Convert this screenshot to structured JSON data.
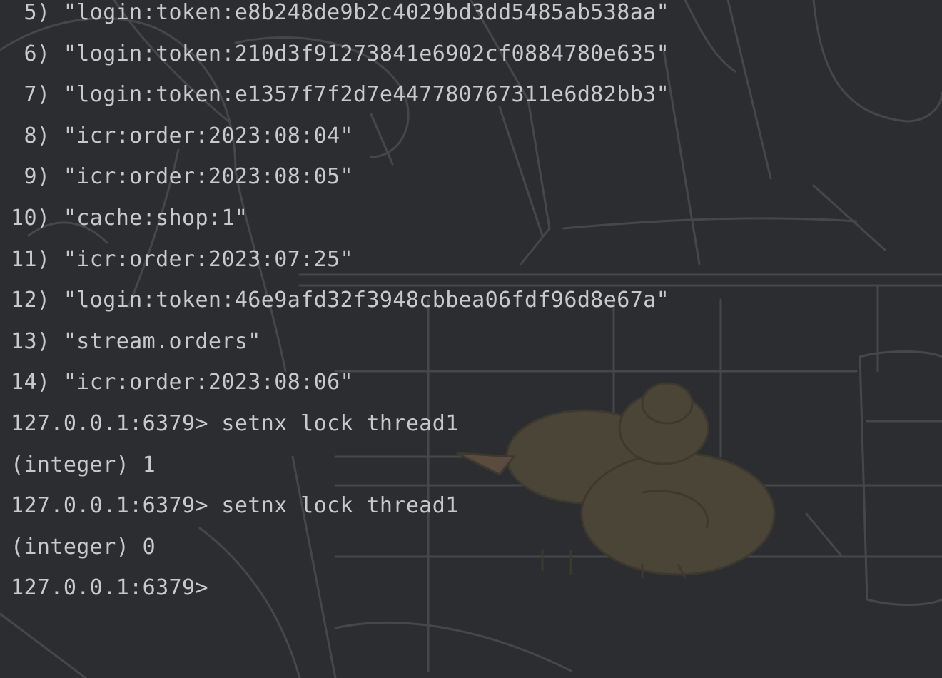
{
  "terminal": {
    "lines": [
      " 5) \"login:token:e8b248de9b2c4029bd3dd5485ab538aa\"",
      " 6) \"login:token:210d3f91273841e6902cf0884780e635\"",
      " 7) \"login:token:e1357f7f2d7e447780767311e6d82bb3\"",
      " 8) \"icr:order:2023:08:04\"",
      " 9) \"icr:order:2023:08:05\"",
      "10) \"cache:shop:1\"",
      "11) \"icr:order:2023:07:25\"",
      "12) \"login:token:46e9afd32f3948cbbea06fdf96d8e67a\"",
      "13) \"stream.orders\"",
      "14) \"icr:order:2023:08:06\"",
      "127.0.0.1:6379> setnx lock thread1",
      "(integer) 1",
      "127.0.0.1:6379> setnx lock thread1",
      "(integer) 0",
      "127.0.0.1:6379>"
    ]
  },
  "colors": {
    "background": "#2b2d30",
    "text": "#c8c9cc",
    "sketch_lines": "#45474b",
    "duck": "#4a4536"
  }
}
